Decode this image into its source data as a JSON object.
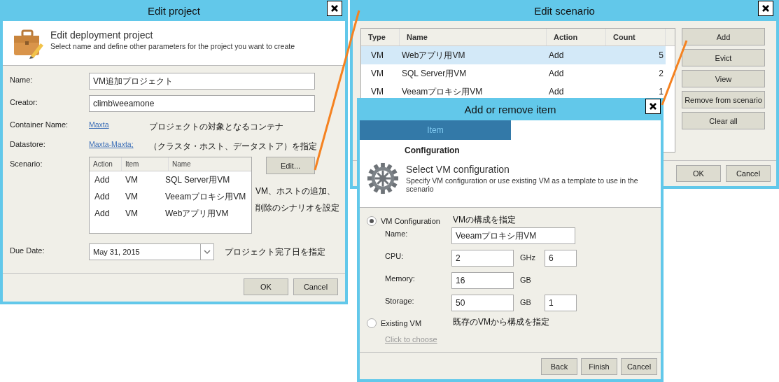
{
  "edit_project": {
    "title": "Edit project",
    "header_title": "Edit deployment project",
    "header_subtitle": "Select name and define other parameters for the project you want to create",
    "fields": [
      {
        "kind": "input",
        "label": "Name:",
        "value": "VM追加プロジェクト"
      },
      {
        "kind": "input",
        "label": "Creator:",
        "value": "climb\\veeamone"
      },
      {
        "kind": "link",
        "label": "Container Name:",
        "value": "Maxta",
        "note": "プロジェクトの対象となるコンテナ"
      },
      {
        "kind": "link",
        "label": "Datastore:",
        "value": "Maxta-Maxta;",
        "note": "（クラスタ・ホスト、データストア）を指定"
      }
    ],
    "scenario": {
      "label": "Scenario:",
      "columns": [
        "Action",
        "Item",
        "Name"
      ],
      "rows": [
        [
          "Add",
          "VM",
          "SQL Server用VM"
        ],
        [
          "Add",
          "VM",
          "Veeamプロキシ用VM"
        ],
        [
          "Add",
          "VM",
          "Webアプリ用VM"
        ]
      ],
      "button": "Edit...",
      "notes": [
        "VM、ホストの追加、",
        "削除のシナリオを設定"
      ]
    },
    "due_date": {
      "label": "Due Date:",
      "value": "May 31, 2015",
      "note": "プロジェクト完了日を指定"
    },
    "buttons": [
      "OK",
      "Cancel"
    ]
  },
  "edit_scenario": {
    "title": "Edit scenario",
    "columns": [
      "Type",
      "Name",
      "Action",
      "Count"
    ],
    "rows": [
      {
        "cells": [
          "VM",
          "Webアプリ用VM",
          "Add",
          "5"
        ],
        "selected": true
      },
      {
        "cells": [
          "VM",
          "SQL Server用VM",
          "Add",
          "2"
        ],
        "selected": false
      },
      {
        "cells": [
          "VM",
          "Veeamプロキシ用VM",
          "Add",
          "1"
        ],
        "selected": false
      }
    ],
    "side_buttons": [
      "Add",
      "Evict",
      "View",
      "Remove from scenario",
      "Clear all"
    ],
    "buttons": [
      "OK",
      "Cancel"
    ]
  },
  "add_remove_item": {
    "title": "Add or remove item",
    "tabs": [
      {
        "label": "Item",
        "selected": true
      }
    ],
    "section": "Configuration",
    "header_title": "Select VM configuration",
    "header_subtitle": "Specify VM configuration or use existing VM as a template to use in the scenario",
    "options": [
      {
        "label": "VM Configuration",
        "selected": true,
        "note": "VMの構成を指定",
        "fields": [
          {
            "kind": "wide",
            "label": "Name:",
            "value": "Veeamプロキシ用VM"
          },
          {
            "kind": "number",
            "label": "CPU:",
            "value": "2",
            "unit": "GHz",
            "extra": "6"
          },
          {
            "kind": "number",
            "label": "Memory:",
            "value": "16",
            "unit": "GB"
          },
          {
            "kind": "number",
            "label": "Storage:",
            "value": "50",
            "unit": "GB",
            "extra": "1"
          }
        ]
      },
      {
        "label": "Existing VM",
        "selected": false,
        "note": "既存のVMから構成を指定",
        "link": {
          "label": "Click to choose",
          "disabled": true
        }
      }
    ],
    "buttons": [
      "Back",
      "Finish",
      "Cancel"
    ]
  }
}
